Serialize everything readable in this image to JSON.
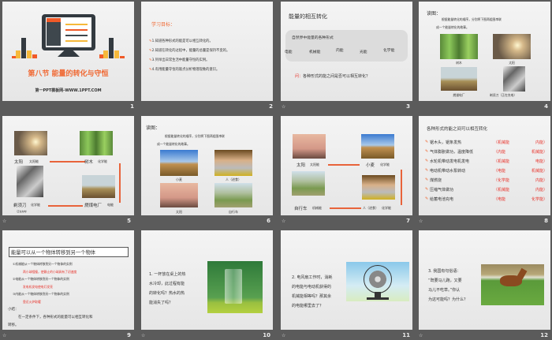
{
  "slides": [
    {
      "number": "1",
      "title": "第八节  能量的转化与守恒",
      "subtitle": "第一PPT模板网-WWW.1PPT.COM"
    },
    {
      "number": "2",
      "heading": "学习目标：",
      "items": [
        "1.知道各种形式的能是可以相互转化的。",
        "2.知道在转化的过程中，能量的总量是保持不变的。",
        "3.列举出日常生活中能量守恒的实例。",
        "4.有用能量守恒的观点分析物理现象的意识。"
      ]
    },
    {
      "number": "3",
      "title": "能量的相互转化",
      "box_title": "自然界中能量的各种形式",
      "forms": [
        "电能",
        "机械能",
        "内能",
        "光能",
        "化学能"
      ],
      "question_label": "问：",
      "question": "各种形式的能之间是否可以相互转化？"
    },
    {
      "number": "4",
      "heading": "读图：",
      "text1": "根据能量转化的顺序，分别将下图两组图串联",
      "text2": "成一个能量转化的故事。",
      "captions": [
        "树木",
        "太阳",
        "燃煤电厂",
        "剃须刀（正在充电）"
      ]
    },
    {
      "number": "5",
      "labels": [
        "太阳",
        "太阳能",
        "树木",
        "化学能",
        "剃须刀",
        "化学能",
        "（正在充电）",
        "燃煤电厂",
        "电能"
      ]
    },
    {
      "number": "6",
      "heading": "读图：",
      "text1": "根据能量转化的顺序，分别将下图两组图串联",
      "text2": "成一个能量转化的故事。",
      "captions": [
        "小麦",
        "人（进食）",
        "太阳",
        "自行车"
      ]
    },
    {
      "number": "7",
      "labels": [
        "太阳",
        "太阳能",
        "小麦",
        "化学能",
        "自行车",
        "机械能",
        "人（进食）",
        "化学能"
      ]
    },
    {
      "number": "8",
      "title": "各种形式的能之间可以相互转化",
      "rows": [
        {
          "text": "锯木头，锯条发热",
          "from": "（机械能",
          "to": "内能）"
        },
        {
          "text": "气体膨胀做功，温度降低",
          "from": "（内能",
          "to": "机械能）"
        },
        {
          "text": "水轮机带动发电机发电",
          "from": "（机械能",
          "to": "电能）"
        },
        {
          "text": "电动机带动水泵转动",
          "from": "（电能",
          "to": "机械能）"
        },
        {
          "text": "煤燃烧",
          "from": "（化学能",
          "to": "内能）"
        },
        {
          "text": "压缩气体做功",
          "from": "（机械能",
          "to": "内能）"
        },
        {
          "text": "给蓄电池充电",
          "from": "（电能",
          "to": "化学能）"
        }
      ]
    },
    {
      "number": "9",
      "title": "能量可以从一个物体转移到另一个物体",
      "lines": [
        {
          "text": "①机械能从一个物体转移到另一个物体的实例",
          "red": false
        },
        {
          "text": "两小球相撞，使静止的小球具有了初速度",
          "red": true
        },
        {
          "text": "②电能从一个物体转移到另一个物体的实例",
          "red": false
        },
        {
          "text": "发电机发电使电灯发亮",
          "red": true
        },
        {
          "text": "③内能从一个物体转移到另一个物体的实例",
          "red": false
        },
        {
          "text": "靠近火炉取暖",
          "red": true
        }
      ],
      "summary_label": "小结：",
      "summary1": "在一定条件下，各种形式的能量可以相互转化和",
      "summary2": "转移。"
    },
    {
      "number": "10",
      "lines": [
        "1. 一杯放在桌上的热",
        "水冷却，此过程有能",
        "的转化吗？热水的热",
        "能消失了吗？"
      ]
    },
    {
      "number": "11",
      "lines": [
        "2. 电风扇工作时，消耗",
        "的电能与电动机获得的",
        "机械能相等吗？那其余",
        "的电能哪里去了？"
      ]
    },
    {
      "number": "12",
      "lines": [
        "3. 我国有句俗语：",
        "“既要马儿跑，又要",
        "马儿不吃草。”你认",
        "为这可能吗？为什么？"
      ]
    }
  ],
  "anim_icon": "animation-star-icon",
  "colors": {
    "accent": "#f06a35",
    "red": "#e8322a",
    "bg": "#5b5b5b"
  }
}
